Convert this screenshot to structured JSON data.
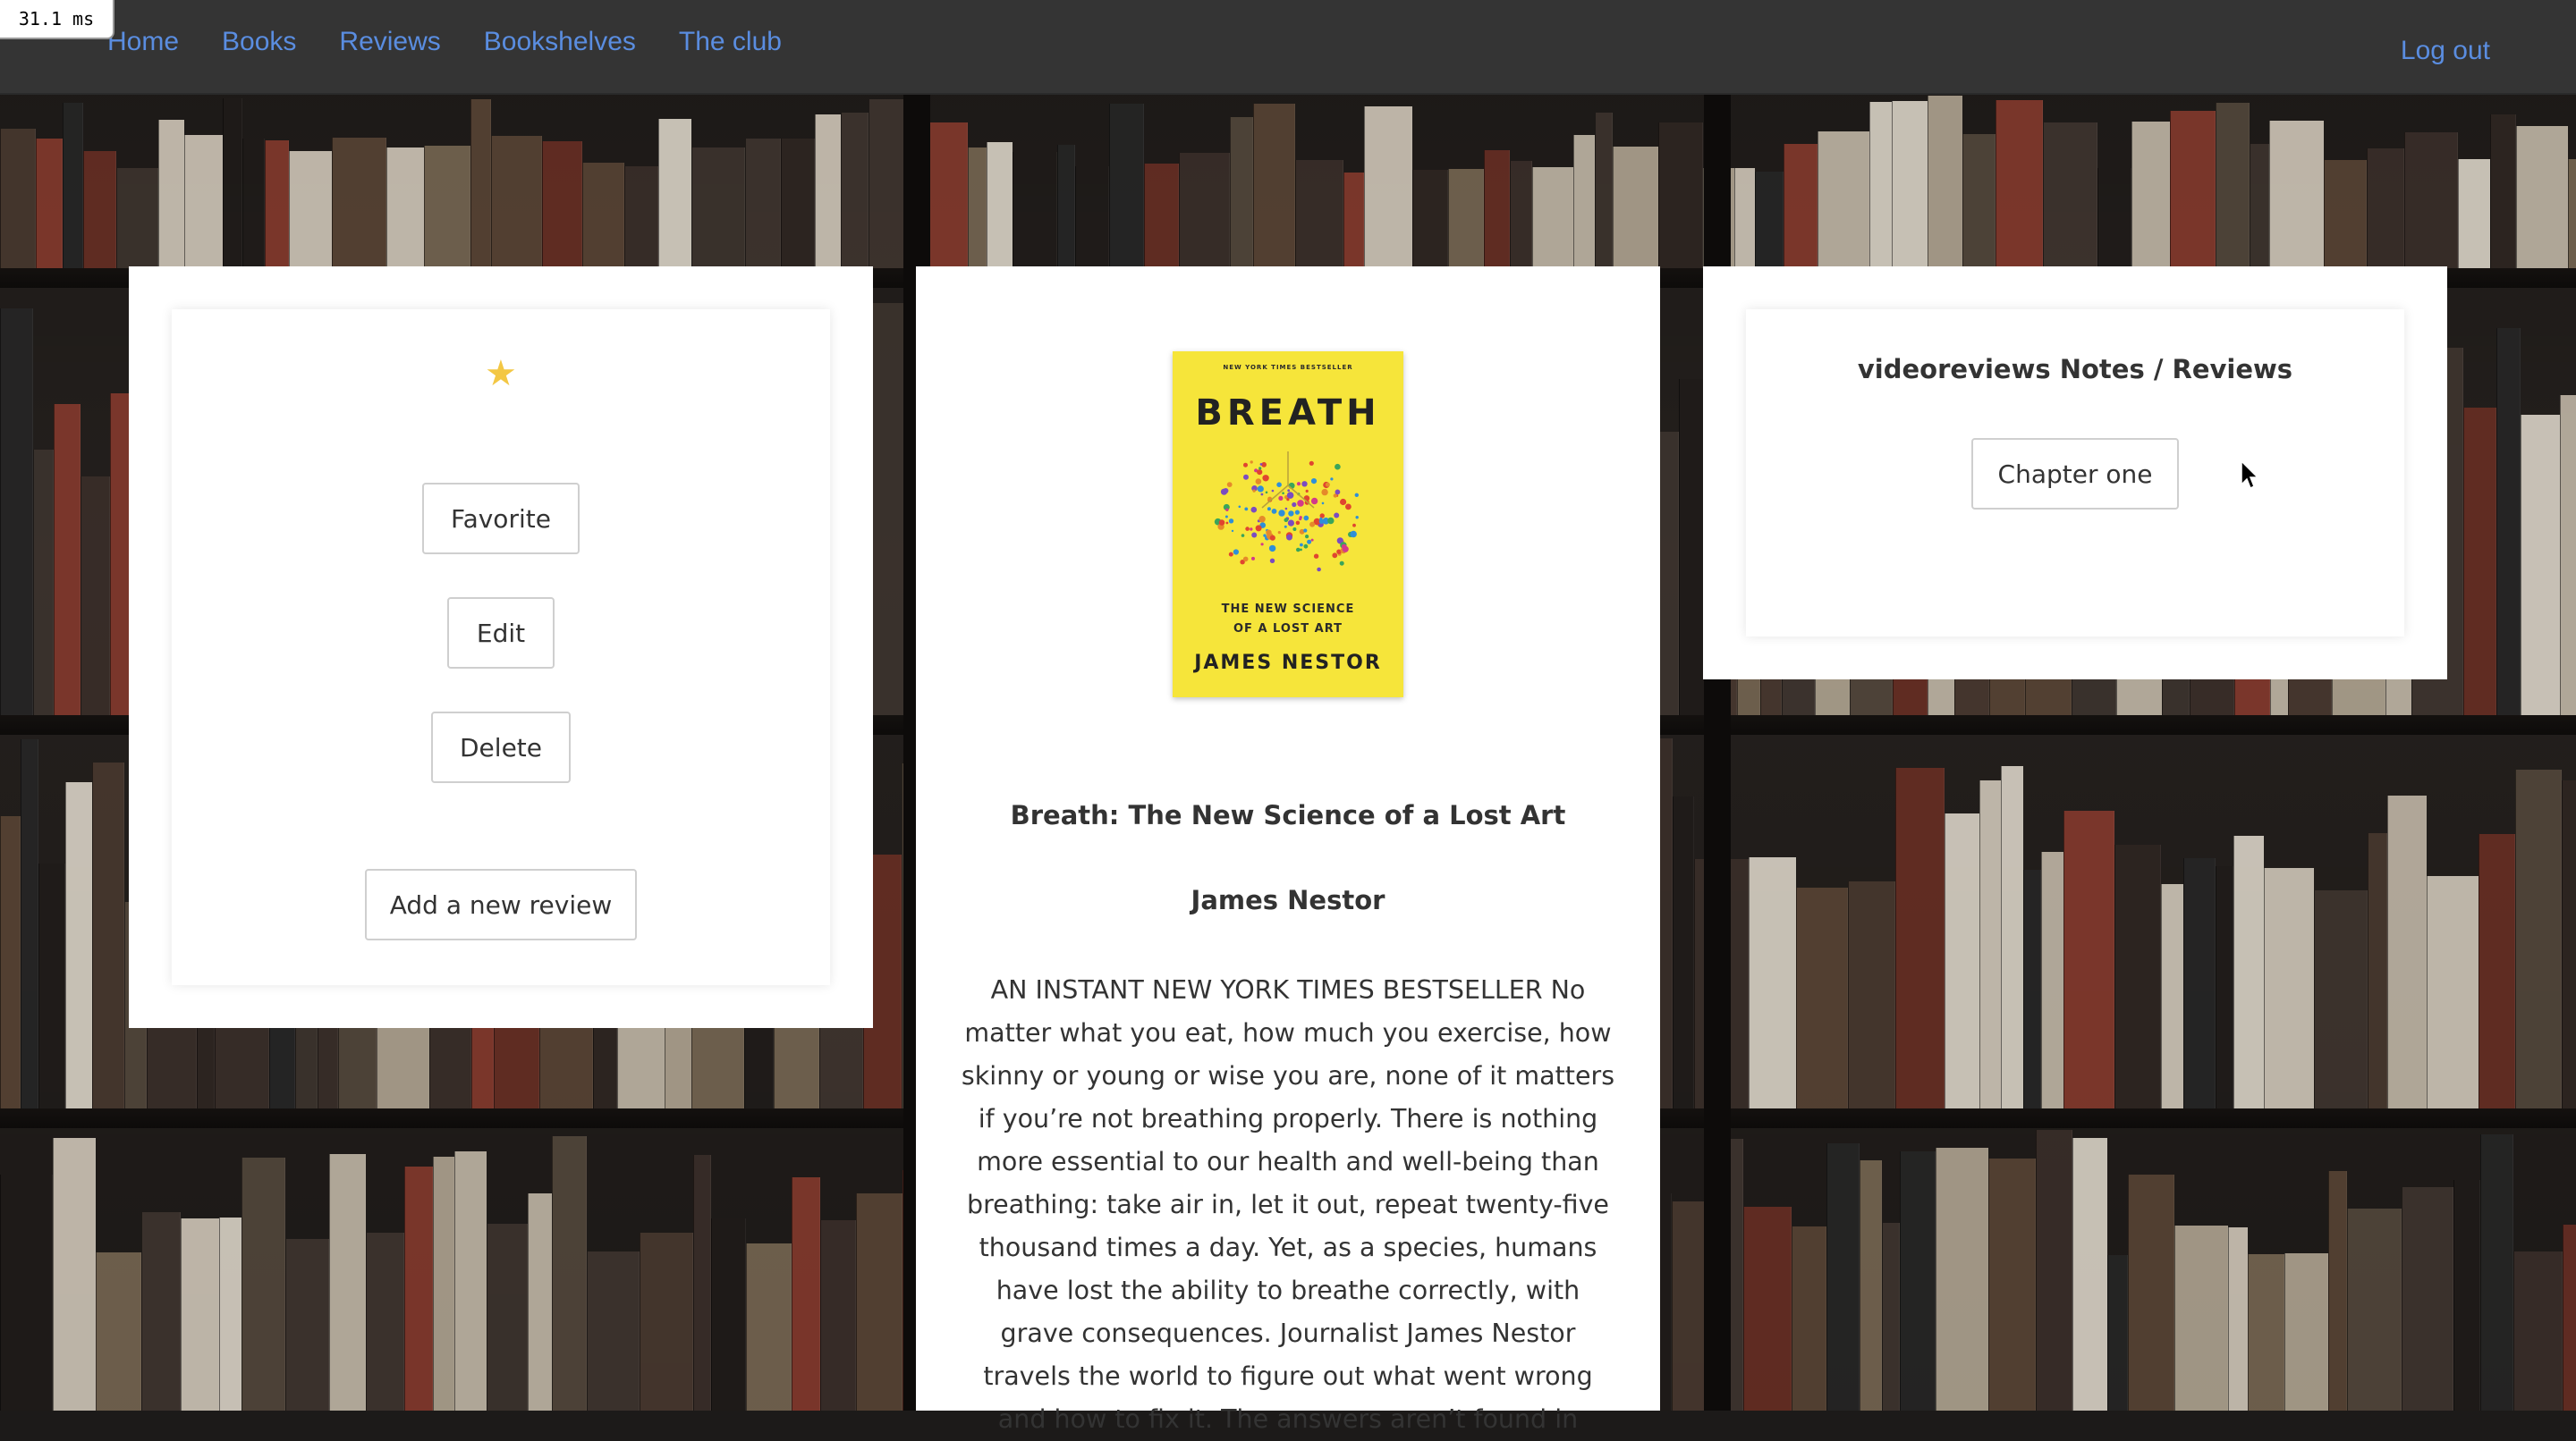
{
  "perf": {
    "label": "31.1 ms"
  },
  "nav": {
    "items": [
      {
        "label": "Home"
      },
      {
        "label": "Books"
      },
      {
        "label": "Reviews"
      },
      {
        "label": "Bookshelves"
      },
      {
        "label": "The club"
      }
    ],
    "logout_label": "Log out",
    "link_color": "#5a8de0"
  },
  "actions": {
    "favorite_icon": "star-icon",
    "favorite_color": "#f3c744",
    "favorite_label": "Favorite",
    "edit_label": "Edit",
    "delete_label": "Delete",
    "add_review_label": "Add a new review"
  },
  "book": {
    "cover": {
      "banner": "NEW YORK TIMES BESTSELLER",
      "title": "BREATH",
      "subtitle_line1": "THE NEW SCIENCE",
      "subtitle_line2": "OF A LOST ART",
      "author": "JAMES NESTOR",
      "background_color": "#f6e53a"
    },
    "title": "Breath: The New Science of a Lost Art",
    "author": "James Nestor",
    "description": "AN INSTANT NEW YORK TIMES BESTSELLER No matter what you eat, how much you exercise, how skinny or young or wise you are, none of it matters if you’re not breathing properly. There is nothing more essential to our health and well-being than breathing: take air in, let it out, repeat twenty-five thousand times a day. Yet, as a species, humans have lost the ability to breathe correctly, with grave consequences. Journalist James Nestor travels the world to figure out what went wrong and how to fix it. The answers aren’t found in"
  },
  "notes": {
    "title": "videoreviews Notes / Reviews",
    "items": [
      {
        "label": "Chapter one"
      }
    ]
  }
}
